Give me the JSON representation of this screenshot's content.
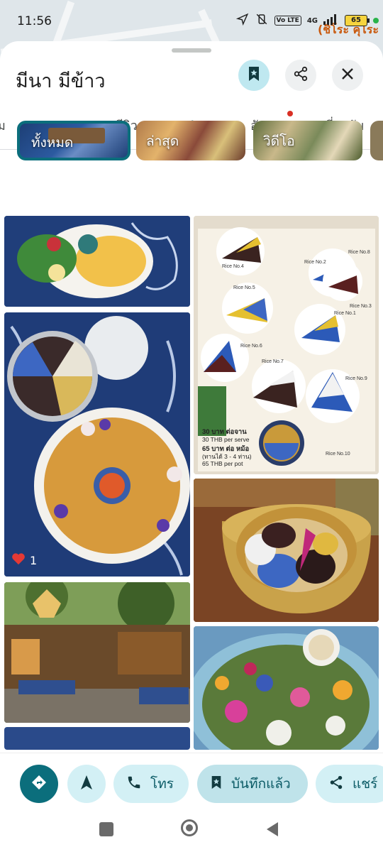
{
  "status_bar": {
    "time": "11:56",
    "network": "4G",
    "volte": "Vo LTE",
    "battery": "65"
  },
  "map": {
    "label": "(ชิโระ คุโระ"
  },
  "place": {
    "name": "มีนา มีข้าว"
  },
  "tabs": [
    {
      "label": "ม"
    },
    {
      "label": "เมนู"
    },
    {
      "label": "รีวิว"
    },
    {
      "label": "รูปภาพ",
      "active": true
    },
    {
      "label": "อัปเดต",
      "has_notification": true
    },
    {
      "label": "เกี่ยวกับ"
    }
  ],
  "photo_filters": [
    {
      "label": "ทั้งหมด",
      "selected": true
    },
    {
      "label": "ล่าสุด"
    },
    {
      "label": "วิดีโอ"
    }
  ],
  "photos": {
    "like_count": "1",
    "menu_card": {
      "price_serve": "30 บาท ต่อจาน",
      "price_serve_en": "30 THB per serve",
      "price_pot": "65 บาท ต่อ หม้อ",
      "price_pot_note": "(ทานได้ 3 - 4 ท่าน)",
      "price_pot_en": "65 THB per pot",
      "rice_labels": [
        "Rice No.4",
        "Rice No.1",
        "Rice No.2",
        "Rice No.3",
        "Rice No.5",
        "Rice No.6",
        "Rice No.7",
        "Rice No.8",
        "Rice No.9",
        "Rice No.10"
      ]
    }
  },
  "actions": {
    "call": "โทร",
    "saved": "บันทึกแล้ว",
    "share": "แชร์"
  },
  "colors": {
    "accent": "#0b6e7c",
    "chip_bg": "#d3f0f5",
    "notification": "#d93025"
  }
}
